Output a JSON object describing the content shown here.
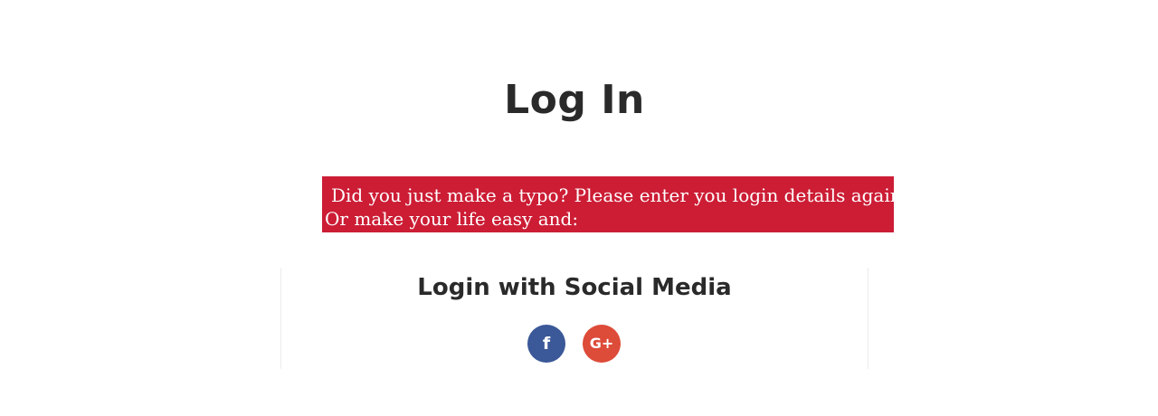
{
  "page": {
    "title": "Log In"
  },
  "error_banner": {
    "line1": "Did you just make a typo? Please enter you login details again.",
    "line2": "Or make your life easy and:",
    "background_color": "#cc1d35"
  },
  "social_login": {
    "heading": "Login with Social Media",
    "buttons": [
      {
        "icon": "facebook-icon",
        "glyph": "f",
        "color": "#3b5898"
      },
      {
        "icon": "google-plus-icon",
        "glyph": "G+",
        "color": "#dd4b39"
      }
    ]
  }
}
